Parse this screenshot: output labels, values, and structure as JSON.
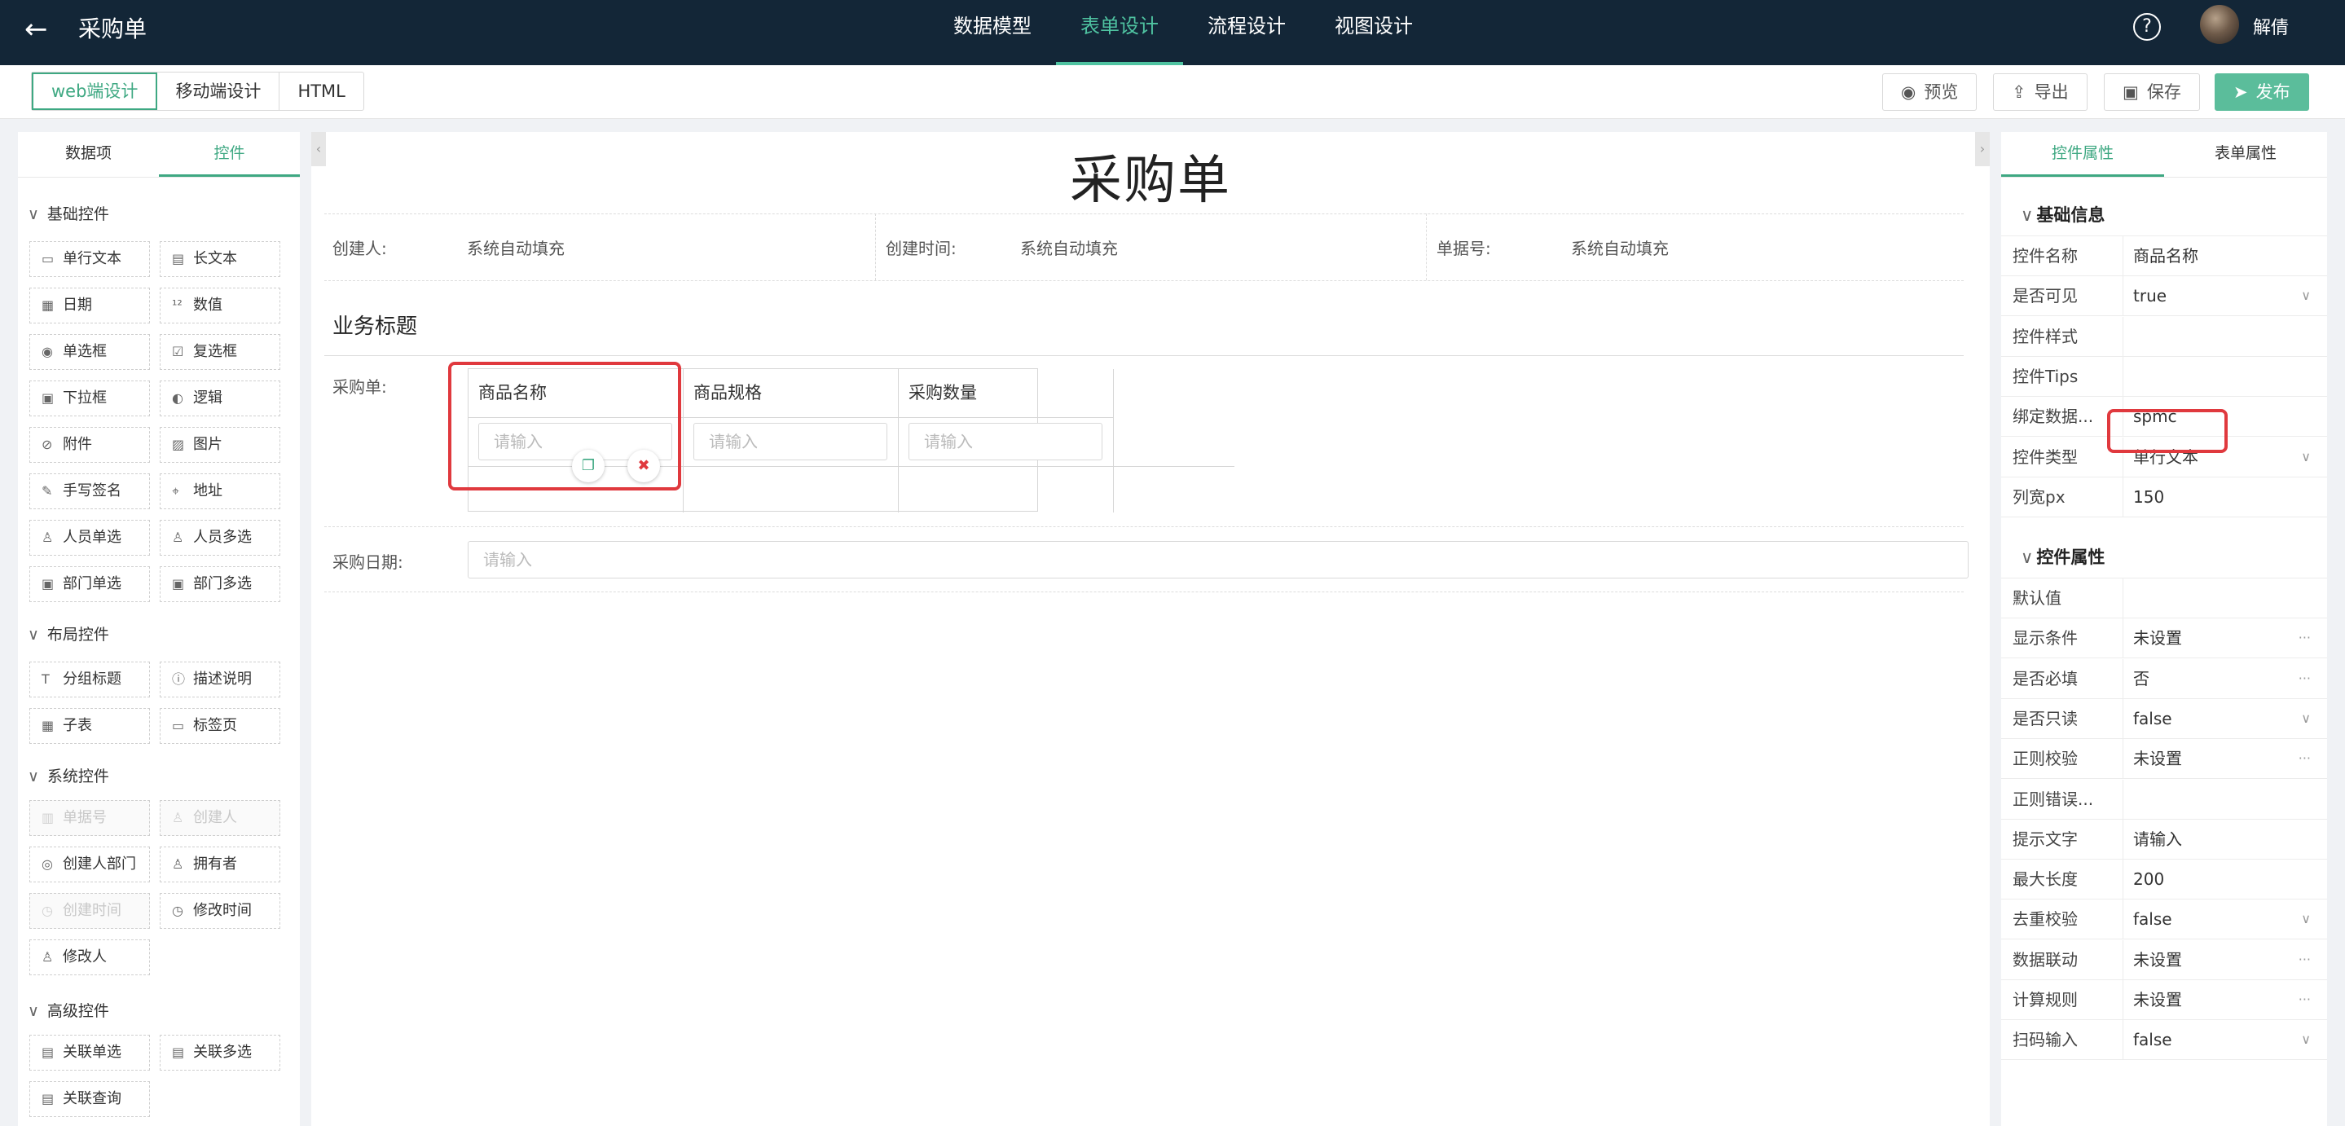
{
  "header": {
    "back_icon": "arrow-left-icon",
    "title": "采购单",
    "tabs": [
      {
        "label": "数据模型",
        "active": false
      },
      {
        "label": "表单设计",
        "active": true
      },
      {
        "label": "流程设计",
        "active": false
      },
      {
        "label": "视图设计",
        "active": false
      }
    ],
    "help_icon": "question-circle-icon",
    "username": "解倩"
  },
  "toolbar": {
    "modes": [
      {
        "label": "web端设计",
        "active": true
      },
      {
        "label": "移动端设计",
        "active": false
      },
      {
        "label": "HTML",
        "active": false
      }
    ],
    "preview": "预览",
    "export": "导出",
    "save": "保存",
    "publish": "发布",
    "accent_color": "#3ea882"
  },
  "left_panel": {
    "tabs": [
      {
        "label": "数据项",
        "active": false
      },
      {
        "label": "控件",
        "active": true
      }
    ],
    "sections": {
      "basic": {
        "title": "基础控件",
        "items": [
          "单行文本",
          "长文本",
          "日期",
          "数值",
          "单选框",
          "复选框",
          "下拉框",
          "逻辑",
          "附件",
          "图片",
          "手写签名",
          "地址",
          "人员单选",
          "人员多选",
          "部门单选",
          "部门多选"
        ]
      },
      "layout": {
        "title": "布局控件",
        "items": [
          "分组标题",
          "描述说明",
          "子表",
          "标签页"
        ]
      },
      "system": {
        "title": "系统控件",
        "items": [
          "单据号",
          "创建人",
          "创建人部门",
          "拥有者",
          "创建时间",
          "修改时间",
          "修改人"
        ],
        "disabled": [
          "单据号",
          "创建人",
          "创建时间"
        ]
      },
      "advanced": {
        "title": "高级控件",
        "items": [
          "关联单选",
          "关联多选",
          "关联查询"
        ]
      }
    }
  },
  "form": {
    "title": "采购单",
    "meta": [
      {
        "label": "创建人:",
        "value": "系统自动填充"
      },
      {
        "label": "创建时间:",
        "value": "系统自动填充"
      },
      {
        "label": "单据号:",
        "value": "系统自动填充"
      }
    ],
    "biz_title": "业务标题",
    "subtable": {
      "label": "采购单:",
      "columns": [
        "商品名称",
        "商品规格",
        "采购数量"
      ],
      "placeholder": "请输入"
    },
    "date_field": {
      "label": "采购日期:",
      "placeholder": "请输入"
    }
  },
  "right_panel": {
    "tabs": [
      {
        "label": "控件属性",
        "active": true
      },
      {
        "label": "表单属性",
        "active": false
      }
    ],
    "basic_group": "基础信息",
    "basic_props": [
      {
        "key": "控件名称",
        "value": "商品名称",
        "end": ""
      },
      {
        "key": "是否可见",
        "value": "true",
        "end": "∨"
      },
      {
        "key": "控件样式",
        "value": "",
        "end": ""
      },
      {
        "key": "控件Tips",
        "value": "",
        "end": ""
      },
      {
        "key": "绑定数据...",
        "value": "spmc",
        "end": ""
      },
      {
        "key": "控件类型",
        "value": "单行文本",
        "end": "∨"
      },
      {
        "key": "列宽px",
        "value": "150",
        "end": ""
      }
    ],
    "ctrl_group": "控件属性",
    "ctrl_props": [
      {
        "key": "默认值",
        "value": "",
        "end": ""
      },
      {
        "key": "显示条件",
        "value": "未设置",
        "end": "···"
      },
      {
        "key": "是否必填",
        "value": "否",
        "end": "···"
      },
      {
        "key": "是否只读",
        "value": "false",
        "end": "∨"
      },
      {
        "key": "正则校验",
        "value": "未设置",
        "end": "···"
      },
      {
        "key": "正则错误...",
        "value": "",
        "end": ""
      },
      {
        "key": "提示文字",
        "value": "请输入",
        "end": ""
      },
      {
        "key": "最大长度",
        "value": "200",
        "end": ""
      },
      {
        "key": "去重校验",
        "value": "false",
        "end": "∨"
      },
      {
        "key": "数据联动",
        "value": "未设置",
        "end": "···"
      },
      {
        "key": "计算规则",
        "value": "未设置",
        "end": "···"
      },
      {
        "key": "扫码输入",
        "value": "false",
        "end": "∨"
      }
    ]
  },
  "icons": {
    "preview": "eye-icon",
    "export": "upload-icon",
    "save": "save-icon",
    "publish": "send-icon",
    "copy": "copy-icon",
    "delete": "trash-icon"
  }
}
